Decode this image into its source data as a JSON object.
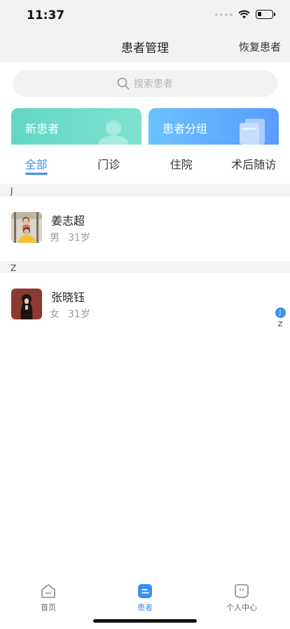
{
  "status": {
    "time": "11:37",
    "battery_level": 0.3
  },
  "nav": {
    "title": "患者管理",
    "action": "恢复患者"
  },
  "search": {
    "placeholder": "搜索患者"
  },
  "cards": {
    "new_patient": "新患者",
    "patient_group": "患者分组"
  },
  "tabs": [
    "全部",
    "门诊",
    "住院",
    "术后随访"
  ],
  "active_tab": 0,
  "sections": [
    {
      "letter": "J",
      "patients": [
        {
          "name": "姜志超",
          "gender": "男",
          "age": "31岁"
        }
      ]
    },
    {
      "letter": "Z",
      "patients": [
        {
          "name": "张晓钰",
          "gender": "女",
          "age": "31岁"
        }
      ]
    }
  ],
  "index_letters": [
    "J",
    "Z"
  ],
  "tabbar": {
    "items": [
      {
        "label": "首页",
        "icon": "home-icon"
      },
      {
        "label": "患者",
        "icon": "patients-icon"
      },
      {
        "label": "个人中心",
        "icon": "profile-icon"
      }
    ],
    "active": 1
  },
  "colors": {
    "accent": "#3a8ff5",
    "card_green": "#63d8c4",
    "card_blue": "#5a9bff"
  }
}
